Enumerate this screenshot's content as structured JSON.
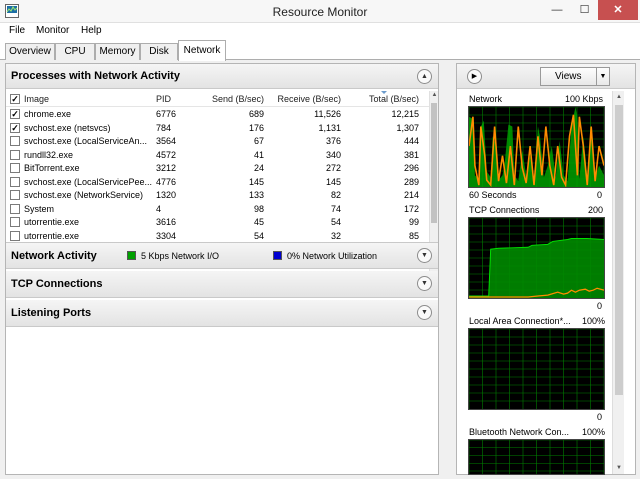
{
  "window": {
    "title": "Resource Monitor",
    "min": "—",
    "max": "☐",
    "close": "✕"
  },
  "menu": [
    "File",
    "Monitor",
    "Help"
  ],
  "tabs": [
    "Overview",
    "CPU",
    "Memory",
    "Disk",
    "Network"
  ],
  "active_tab": "Network",
  "processes": {
    "title": "Processes with Network Activity",
    "columns": {
      "image": "Image",
      "pid": "PID",
      "send": "Send (B/sec)",
      "receive": "Receive (B/sec)",
      "total": "Total (B/sec)"
    },
    "rows": [
      {
        "checked": true,
        "image": "chrome.exe",
        "pid": "6776",
        "send": "689",
        "receive": "11,526",
        "total": "12,215"
      },
      {
        "checked": true,
        "image": "svchost.exe (netsvcs)",
        "pid": "784",
        "send": "176",
        "receive": "1,131",
        "total": "1,307"
      },
      {
        "checked": false,
        "image": "svchost.exe (LocalServiceAn...",
        "pid": "3564",
        "send": "67",
        "receive": "376",
        "total": "444"
      },
      {
        "checked": false,
        "image": "rundll32.exe",
        "pid": "4572",
        "send": "41",
        "receive": "340",
        "total": "381"
      },
      {
        "checked": false,
        "image": "BitTorrent.exe",
        "pid": "3212",
        "send": "24",
        "receive": "272",
        "total": "296"
      },
      {
        "checked": false,
        "image": "svchost.exe (LocalServicePee...",
        "pid": "4776",
        "send": "145",
        "receive": "145",
        "total": "289"
      },
      {
        "checked": false,
        "image": "svchost.exe (NetworkService)",
        "pid": "1320",
        "send": "133",
        "receive": "82",
        "total": "214"
      },
      {
        "checked": false,
        "image": "System",
        "pid": "4",
        "send": "98",
        "receive": "74",
        "total": "172"
      },
      {
        "checked": false,
        "image": "utorrentie.exe",
        "pid": "3616",
        "send": "45",
        "receive": "54",
        "total": "99"
      },
      {
        "checked": false,
        "image": "utorrentie.exe",
        "pid": "3304",
        "send": "54",
        "receive": "32",
        "total": "85"
      }
    ]
  },
  "network_activity": {
    "title": "Network Activity",
    "io_label": "5 Kbps Network I/O",
    "io_color": "#00a000",
    "util_label": "0% Network Utilization",
    "util_color": "#0000d0"
  },
  "tcp_title": "TCP Connections",
  "listening_title": "Listening Ports",
  "right": {
    "views_label": "Views",
    "graphs": [
      {
        "name": "Network",
        "max": "100 Kbps",
        "footer": "60 Seconds",
        "footer_right": "0"
      },
      {
        "name": "TCP Connections",
        "max": "200",
        "footer_right": "0"
      },
      {
        "name": "Local Area Connection*...",
        "max": "100%",
        "footer_right": "0"
      },
      {
        "name": "Bluetooth Network Con...",
        "max": "100%"
      }
    ]
  },
  "colors": {
    "graph_bg": "#000000",
    "grid": "#008000",
    "green_series": "#00e000",
    "orange_series": "#ff8c00",
    "green_fill": "#008a00"
  }
}
